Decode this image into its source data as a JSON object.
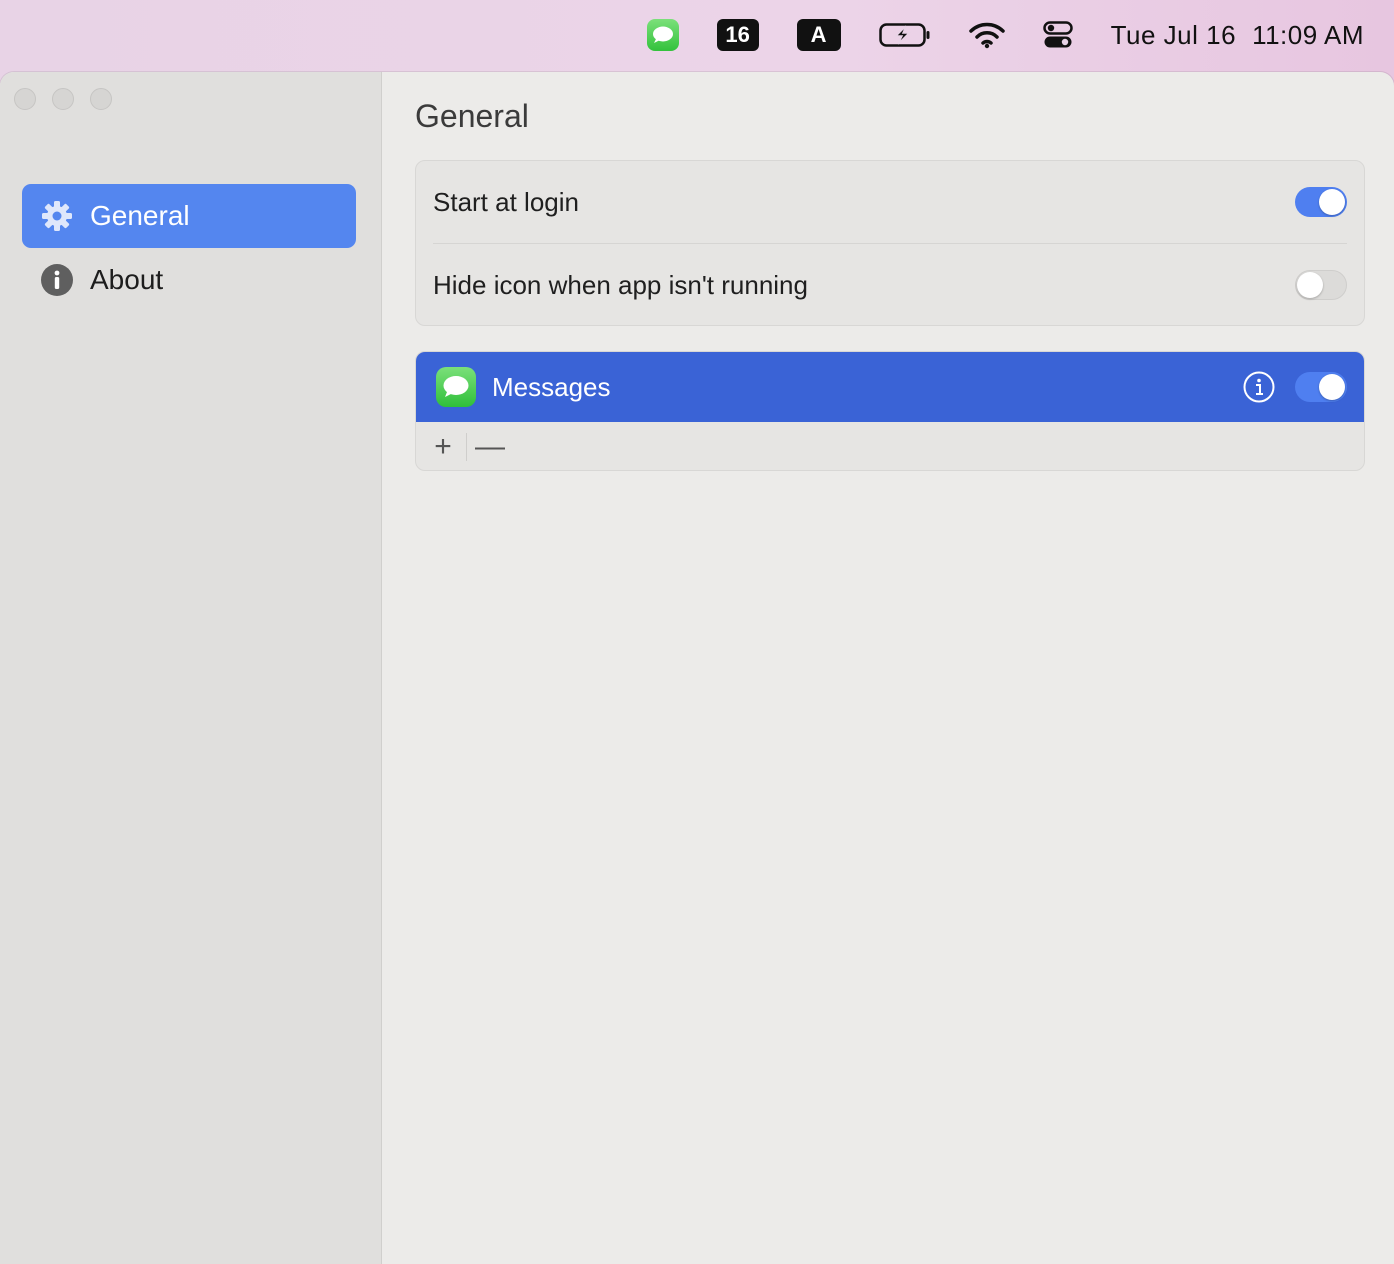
{
  "menubar": {
    "calendar_day": "16",
    "input_source": "A",
    "date": "Tue Jul 16",
    "time": "11:09 AM",
    "icons": [
      "messages-icon",
      "calendar-icon",
      "input-source-icon",
      "battery-charging-icon",
      "wifi-icon",
      "control-center-icon"
    ]
  },
  "sidebar": {
    "items": [
      {
        "label": "General",
        "icon": "gear-icon",
        "selected": true
      },
      {
        "label": "About",
        "icon": "info-icon",
        "selected": false
      }
    ]
  },
  "main": {
    "title": "General",
    "settings": [
      {
        "label": "Start at login",
        "enabled": true
      },
      {
        "label": "Hide icon when app isn't running",
        "enabled": false
      }
    ],
    "apps": [
      {
        "label": "Messages",
        "icon": "messages-icon",
        "enabled": true,
        "selected": true
      }
    ],
    "footer": {
      "add": "+",
      "remove": "—"
    }
  },
  "colors": {
    "accent": "#5486ef",
    "selection": "#3a63d6",
    "toggle_on": "#4f7ff0"
  }
}
